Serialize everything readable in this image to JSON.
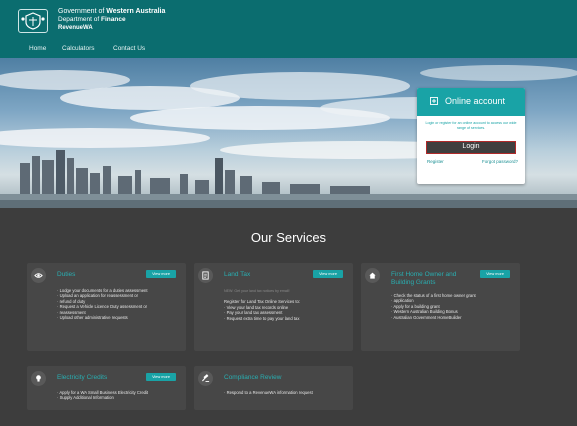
{
  "header": {
    "brand_line1_prefix": "Government of",
    "brand_line1_bold": "Western Australia",
    "brand_line2_prefix": "Department of",
    "brand_line2_bold": "Finance",
    "brand_line3": "RevenueWA",
    "crest_icon": "wa-crest-icon"
  },
  "nav": [
    {
      "label": "Home"
    },
    {
      "label": "Calculators"
    },
    {
      "label": "Contact Us"
    }
  ],
  "account": {
    "title": "Online account",
    "description": "Login or register for an online account to access our wide range of services.",
    "login_label": "Login",
    "register_label": "Register",
    "forgot_label": "Forgot password?",
    "icon": "login-box-icon"
  },
  "services": {
    "title": "Our Services",
    "cards": [
      {
        "title": "Duties",
        "view_label": "View more",
        "icon": "eye-icon",
        "items": [
          "Lodge your documents for a duties assessment",
          "Upload an application for reassessment or",
          "refund of duty",
          "Request a Vehicle Licence Duty assessment or",
          "reassessment",
          "Upload other administrative requests"
        ]
      },
      {
        "title": "Land Tax",
        "view_label": "View more",
        "icon": "document-icon",
        "note": "NEW: Get your land tax notices by email!",
        "intro": "Register for Land Tax Online Services to:",
        "items": [
          "View your land tax records online",
          "Pay your land tax assessment",
          "Request extra time to pay your land tax"
        ]
      },
      {
        "title_line1": "First Home Owner and",
        "title_line2": "Building Grants",
        "view_label": "View more",
        "icon": "home-icon",
        "items": [
          "Check the status of a first home owner grant",
          "application",
          "Apply for a building grant",
          "Western Australian Building Bonus",
          "Australian Government HomeBuilder"
        ]
      },
      {
        "title": "Electricity Credits",
        "view_label": "View more",
        "icon": "lightbulb-icon",
        "items": [
          "Apply for a WA Small Business Electricity Credit",
          "Supply Additional Information"
        ]
      },
      {
        "title": "Compliance Review",
        "icon": "gavel-icon",
        "items": [
          "Respond to a RevenueWA information request"
        ]
      }
    ]
  },
  "colors": {
    "header_bg": "#0b6d6f",
    "accent": "#19a3a6",
    "services_bg": "#3d3d3d",
    "card_bg": "#474747"
  }
}
